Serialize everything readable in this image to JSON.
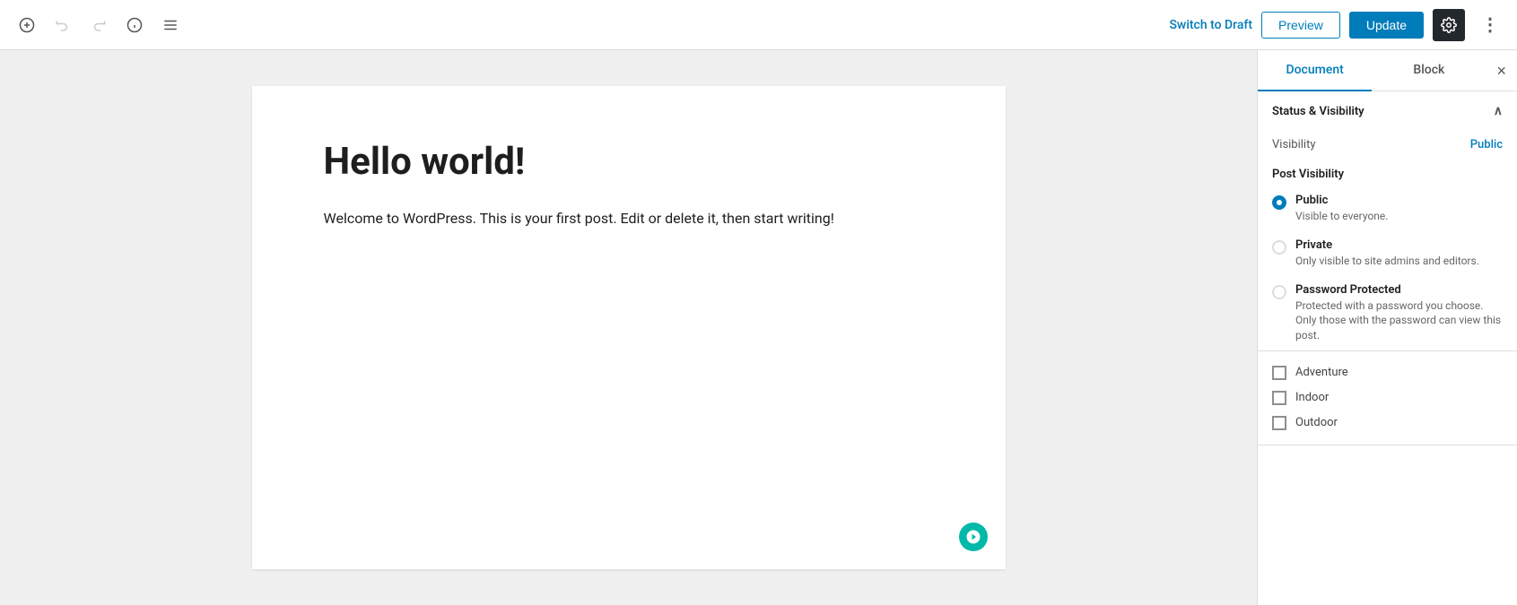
{
  "toolbar": {
    "add_label": "+",
    "undo_label": "↩",
    "redo_label": "↪",
    "info_label": "ℹ",
    "list_view_label": "≡",
    "switch_to_draft_label": "Switch to Draft",
    "preview_label": "Preview",
    "update_label": "Update",
    "settings_label": "⚙",
    "more_label": "⋮"
  },
  "editor": {
    "title": "Hello world!",
    "body": "Welcome to WordPress. This is your first post. Edit or delete it, then start writing!"
  },
  "sidebar": {
    "tab_document": "Document",
    "tab_block": "Block",
    "close_label": "×",
    "status_visibility_header": "Status & Visibility",
    "visibility_label": "Visibility",
    "visibility_value": "Public",
    "post_visibility_header": "Post Visibility",
    "options": [
      {
        "id": "public",
        "label": "Public",
        "desc": "Visible to everyone.",
        "checked": true
      },
      {
        "id": "private",
        "label": "Private",
        "desc": "Only visible to site admins and editors.",
        "checked": false
      },
      {
        "id": "password",
        "label": "Password Protected",
        "desc": "Protected with a password you choose. Only those with the password can view this post.",
        "checked": false
      }
    ],
    "categories": [
      {
        "label": "Adventure",
        "checked": false
      },
      {
        "label": "Indoor",
        "checked": false
      },
      {
        "label": "Outdoor",
        "checked": false
      }
    ]
  },
  "colors": {
    "accent": "#007cba",
    "update_bg": "#007cba",
    "settings_bg": "#23282d",
    "gravatar_bg": "#00b9a8"
  }
}
